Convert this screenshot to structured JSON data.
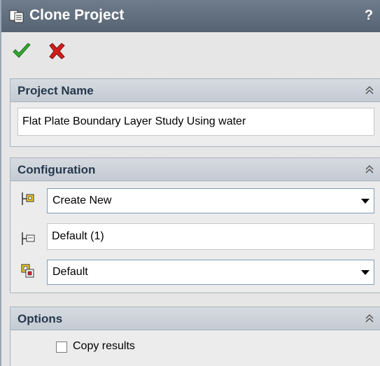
{
  "title_bar": {
    "title": "Clone Project",
    "help_label": "?",
    "icon": "clone-project-icon"
  },
  "actions": {
    "ok_icon": "green-check-icon",
    "cancel_icon": "red-x-icon"
  },
  "project_name_group": {
    "title": "Project Name",
    "value": "Flat Plate Boundary Layer Study Using water"
  },
  "configuration_group": {
    "title": "Configuration",
    "mode_value": "Create New",
    "name_value": "Default (1)",
    "base_value": "Default"
  },
  "options_group": {
    "title": "Options",
    "copy_results_label": "Copy results",
    "copy_results_checked": false
  },
  "colors": {
    "title_bar": "#5f6c7c",
    "group_header": "#cdd3da",
    "ok_green": "#2fa22f",
    "cancel_red": "#d01818"
  }
}
